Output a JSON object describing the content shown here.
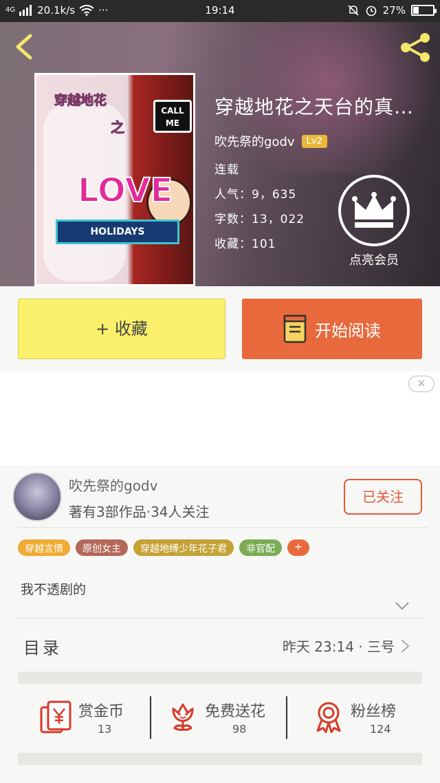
{
  "status_bar": {
    "network": "4G",
    "speed": "20.1k/s",
    "dots": "···",
    "time": "19:14",
    "battery": "27%",
    "battery_level": 0.27
  },
  "book": {
    "title": "穿越地花之天台的真…",
    "author": "吹先祭的godv",
    "level": "Lv2",
    "status": "连载",
    "popularity": "人气：9，635",
    "words": "字数：13，022",
    "favorites": "收藏：101",
    "vip_label": "点亮会员",
    "cover_art": {
      "title": "穿越地花",
      "zhi": "之",
      "call_me": "CALL ME",
      "love": "LOVE",
      "holidays": "HOLIDAYS"
    }
  },
  "actions": {
    "favorite": "+ 收藏",
    "start_reading": "开始阅读"
  },
  "ad": {
    "close": "×"
  },
  "author_card": {
    "name": "吹先祭的godv",
    "stats": "著有3部作品·34人关注",
    "follow": "已关注"
  },
  "tags": [
    {
      "label": "穿越言情",
      "color": "#eeaa33"
    },
    {
      "label": "原创女主",
      "color": "#b4685a"
    },
    {
      "label": "穿越地缚少年花子君",
      "color": "#c4a236"
    },
    {
      "label": "非官配",
      "color": "#7bac54"
    },
    {
      "label": "+",
      "color": "#e86a3c"
    }
  ],
  "synopsis": "我不透剧的",
  "catalog": {
    "label": "目录",
    "update": "昨天 23:14 · 三号"
  },
  "rewards": [
    {
      "title": "赏金币",
      "count": "13",
      "icon": "red-envelope-yen-icon"
    },
    {
      "title": "免费送花",
      "count": "98",
      "icon": "flower-icon"
    },
    {
      "title": "粉丝榜",
      "count": "124",
      "icon": "award-medal-icon"
    }
  ],
  "bottom_peek": "",
  "colors": {
    "accent": "#e8693c",
    "favorite_button": "#faf06c",
    "level_badge": "#e9b83a",
    "icon_red": "#d63a2a"
  }
}
